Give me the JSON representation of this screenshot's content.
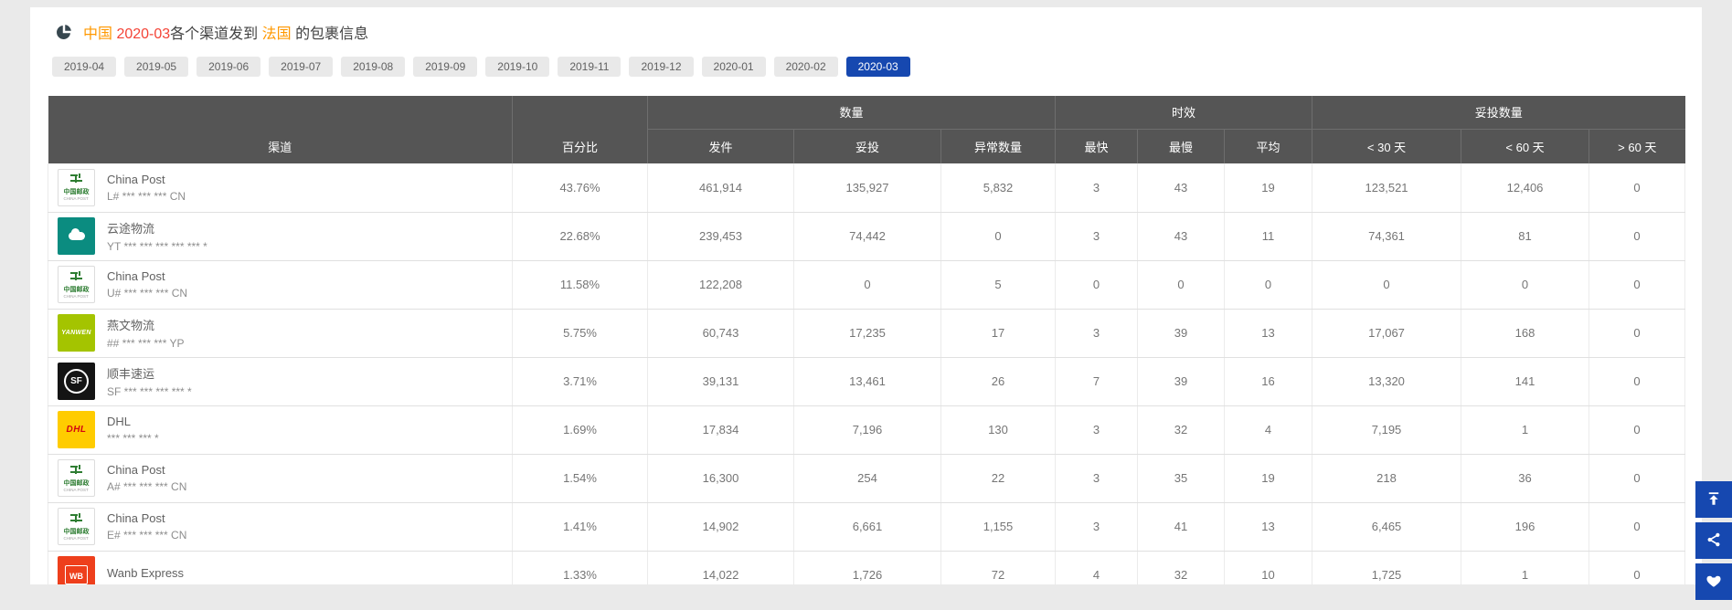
{
  "header": {
    "icon": "pie-chart-icon",
    "title_parts": [
      {
        "text": "中国 ",
        "color": "#ff9800"
      },
      {
        "text": "2020-03",
        "color": "#f44336"
      },
      {
        "text": "各个渠道发到 ",
        "color": "#424242"
      },
      {
        "text": "法国",
        "color": "#ff9800"
      },
      {
        "text": " 的包裹信息",
        "color": "#424242"
      }
    ]
  },
  "tabs": {
    "items": [
      "2019-04",
      "2019-05",
      "2019-06",
      "2019-07",
      "2019-08",
      "2019-09",
      "2019-10",
      "2019-11",
      "2019-12",
      "2020-01",
      "2020-02",
      "2020-03"
    ],
    "selected": "2020-03",
    "selected_color": "#1648b0"
  },
  "table": {
    "group_headers": [
      {
        "label": "数量",
        "span": 3
      },
      {
        "label": "时效",
        "span": 3
      },
      {
        "label": "妥投数量",
        "span": 3
      }
    ],
    "columns": [
      "渠道",
      "百分比",
      "发件",
      "妥投",
      "异常数量",
      "最快",
      "最慢",
      "平均",
      "< 30 天",
      "< 60 天",
      "> 60 天"
    ],
    "rows": [
      {
        "logo": {
          "style": "china-post",
          "text": "中国邮政",
          "subtext": "CHINA POST"
        },
        "name": "China Post",
        "code": "L# *** *** *** CN",
        "percent": "43.76%",
        "values": [
          "461,914",
          "135,927",
          "5,832",
          "3",
          "43",
          "19",
          "123,521",
          "12,406",
          "0"
        ]
      },
      {
        "logo": {
          "style": "yunexpress",
          "text": "",
          "subtext": ""
        },
        "name": "云途物流",
        "code": "YT *** *** *** *** *** *",
        "percent": "22.68%",
        "values": [
          "239,453",
          "74,442",
          "0",
          "3",
          "43",
          "11",
          "74,361",
          "81",
          "0"
        ]
      },
      {
        "logo": {
          "style": "china-post",
          "text": "中国邮政",
          "subtext": "CHINA POST"
        },
        "name": "China Post",
        "code": "U# *** *** *** CN",
        "percent": "11.58%",
        "values": [
          "122,208",
          "0",
          "5",
          "0",
          "0",
          "0",
          "0",
          "0",
          "0"
        ]
      },
      {
        "logo": {
          "style": "yanwen",
          "text": "YANWEN",
          "subtext": ""
        },
        "name": "燕文物流",
        "code": "## *** *** *** YP",
        "percent": "5.75%",
        "values": [
          "60,743",
          "17,235",
          "17",
          "3",
          "39",
          "13",
          "17,067",
          "168",
          "0"
        ]
      },
      {
        "logo": {
          "style": "sf",
          "text": "SF",
          "subtext": ""
        },
        "name": "顺丰速运",
        "code": "SF *** *** *** *** *",
        "percent": "3.71%",
        "values": [
          "39,131",
          "13,461",
          "26",
          "7",
          "39",
          "16",
          "13,320",
          "141",
          "0"
        ]
      },
      {
        "logo": {
          "style": "dhl",
          "text": "DHL",
          "subtext": ""
        },
        "name": "DHL",
        "code": "*** *** *** *",
        "percent": "1.69%",
        "values": [
          "17,834",
          "7,196",
          "130",
          "3",
          "32",
          "4",
          "7,195",
          "1",
          "0"
        ]
      },
      {
        "logo": {
          "style": "china-post",
          "text": "中国邮政",
          "subtext": "CHINA POST"
        },
        "name": "China Post",
        "code": "A# *** *** *** CN",
        "percent": "1.54%",
        "values": [
          "16,300",
          "254",
          "22",
          "3",
          "35",
          "19",
          "218",
          "36",
          "0"
        ]
      },
      {
        "logo": {
          "style": "china-post",
          "text": "中国邮政",
          "subtext": "CHINA POST"
        },
        "name": "China Post",
        "code": "E# *** *** *** CN",
        "percent": "1.41%",
        "values": [
          "14,902",
          "6,661",
          "1,155",
          "3",
          "41",
          "13",
          "6,465",
          "196",
          "0"
        ]
      },
      {
        "logo": {
          "style": "wanb",
          "text": "WB",
          "subtext": ""
        },
        "name": "Wanb Express",
        "code": "",
        "percent": "1.33%",
        "values": [
          "14,022",
          "1,726",
          "72",
          "4",
          "32",
          "10",
          "1,725",
          "1",
          "0"
        ]
      }
    ]
  },
  "floating_buttons": {
    "color": "#1648b0",
    "items": [
      "back-to-top",
      "share",
      "favorite"
    ]
  }
}
